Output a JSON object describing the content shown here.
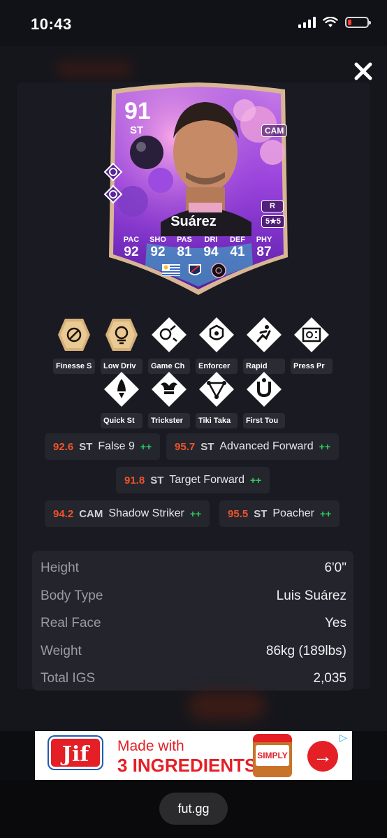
{
  "status_bar": {
    "time": "10:43"
  },
  "card": {
    "rating": "91",
    "position": "ST",
    "alt_position": "CAM",
    "preferred_foot": "R",
    "skill_weak": "5★5",
    "name": "Suárez",
    "stat_labels": [
      "PAC",
      "SHO",
      "PAS",
      "DRI",
      "DEF",
      "PHY"
    ],
    "stat_values": [
      "92",
      "92",
      "81",
      "94",
      "41",
      "87"
    ],
    "colors": {
      "card_purple": "#8b3fd6",
      "frame_gold": "#d8b48a"
    }
  },
  "playstyles": [
    {
      "label": "Finesse S",
      "icon": "finesse-shot-icon",
      "plus": true
    },
    {
      "label": "Low Driv",
      "icon": "low-driven-shot-icon",
      "plus": true
    },
    {
      "label": "Game Ch",
      "icon": "game-changer-icon",
      "plus": false
    },
    {
      "label": "Enforcer",
      "icon": "enforcer-icon",
      "plus": false
    },
    {
      "label": "Rapid",
      "icon": "rapid-icon",
      "plus": false
    },
    {
      "label": "Press Pr",
      "icon": "press-proven-icon",
      "plus": false
    },
    {
      "label": "Quick St",
      "icon": "quick-step-icon",
      "plus": false
    },
    {
      "label": "Trickster",
      "icon": "trickster-icon",
      "plus": false
    },
    {
      "label": "Tiki Taka",
      "icon": "tiki-taka-icon",
      "plus": false
    },
    {
      "label": "First Tou",
      "icon": "first-touch-icon",
      "plus": false
    }
  ],
  "roles": [
    {
      "score": "92.6",
      "pos": "ST",
      "name": "False 9",
      "plus": "++"
    },
    {
      "score": "95.7",
      "pos": "ST",
      "name": "Advanced Forward",
      "plus": "++"
    },
    {
      "score": "91.8",
      "pos": "ST",
      "name": "Target Forward",
      "plus": "++"
    },
    {
      "score": "94.2",
      "pos": "CAM",
      "name": "Shadow Striker",
      "plus": "++"
    },
    {
      "score": "95.5",
      "pos": "ST",
      "name": "Poacher",
      "plus": "++"
    }
  ],
  "info": [
    {
      "label": "Height",
      "value": "6'0\""
    },
    {
      "label": "Body Type",
      "value": "Luis Suárez"
    },
    {
      "label": "Real Face",
      "value": "Yes"
    },
    {
      "label": "Weight",
      "value": "86kg (189lbs)"
    },
    {
      "label": "Total IGS",
      "value": "2,035"
    }
  ],
  "ad": {
    "brand": "Jif",
    "line1": "Made with",
    "line2": "3 INGREDIENTS",
    "jar_label": "SIMPLY"
  },
  "browser": {
    "url": "fut.gg"
  }
}
